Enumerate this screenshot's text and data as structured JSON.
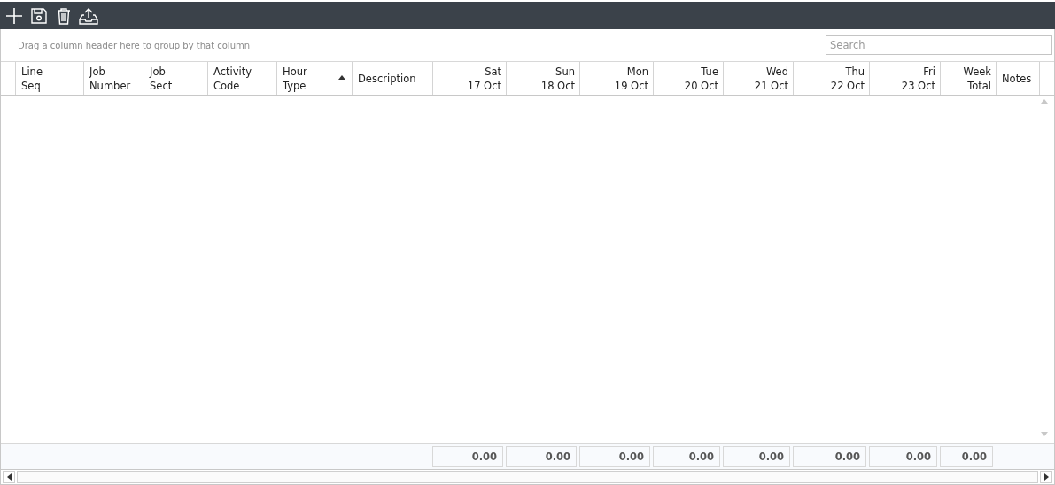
{
  "group_panel": {
    "hint": "Drag a column header here to group by that column"
  },
  "search": {
    "placeholder": "Search"
  },
  "columns": [
    {
      "label": "Line\nSeq",
      "kind": "text",
      "sorted": false
    },
    {
      "label": "Job\nNumber",
      "kind": "text",
      "sorted": false
    },
    {
      "label": "Job\nSect",
      "kind": "text",
      "sorted": false
    },
    {
      "label": "Activity\nCode",
      "kind": "text",
      "sorted": false
    },
    {
      "label": "Hour\nType",
      "kind": "text",
      "sorted": true
    },
    {
      "label": "Description",
      "kind": "text",
      "sorted": false
    },
    {
      "label": "Sat\n17 Oct",
      "kind": "number",
      "sorted": false,
      "total": "0.00"
    },
    {
      "label": "Sun\n18 Oct",
      "kind": "number",
      "sorted": false,
      "total": "0.00"
    },
    {
      "label": "Mon\n19 Oct",
      "kind": "number",
      "sorted": false,
      "total": "0.00"
    },
    {
      "label": "Tue\n20 Oct",
      "kind": "number",
      "sorted": false,
      "total": "0.00"
    },
    {
      "label": "Wed\n21 Oct",
      "kind": "number",
      "sorted": false,
      "total": "0.00"
    },
    {
      "label": "Thu\n22 Oct",
      "kind": "number",
      "sorted": false,
      "total": "0.00"
    },
    {
      "label": "Fri\n23 Oct",
      "kind": "number",
      "sorted": false,
      "total": "0.00"
    },
    {
      "label": "Week\nTotal",
      "kind": "number",
      "sorted": false,
      "total": "0.00"
    },
    {
      "label": "Notes",
      "kind": "text",
      "sorted": false
    }
  ]
}
